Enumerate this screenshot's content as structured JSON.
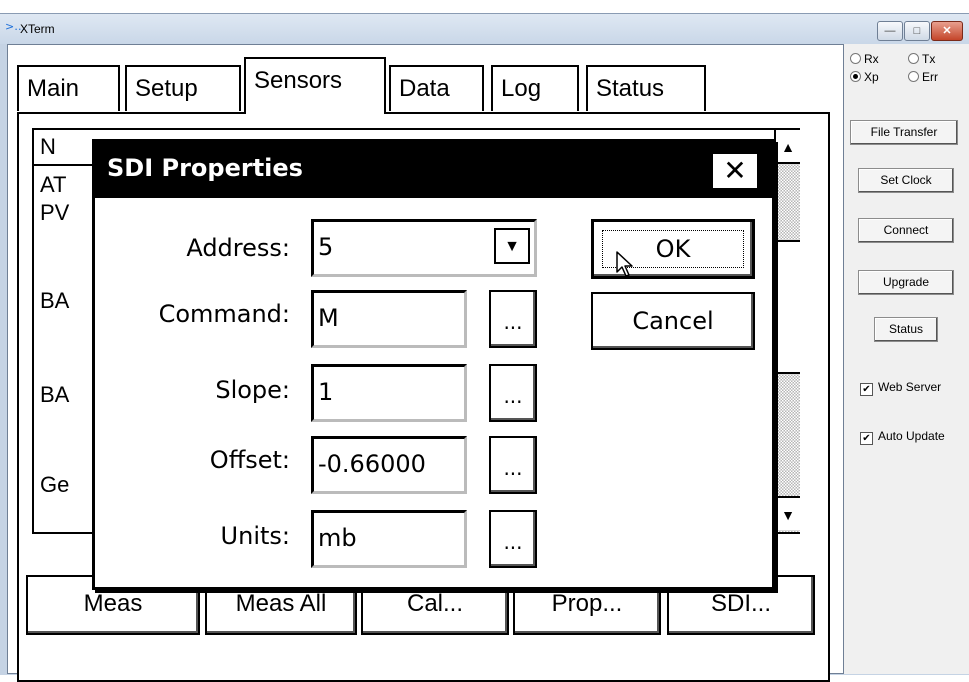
{
  "window": {
    "title": "XTerm",
    "icon": "xterm-app-icon",
    "controls": [
      "minimize",
      "maximize",
      "close"
    ]
  },
  "tabs": [
    {
      "label": "Main"
    },
    {
      "label": "Setup"
    },
    {
      "label": "Sensors",
      "active": true
    },
    {
      "label": "Data"
    },
    {
      "label": "Log"
    },
    {
      "label": "Status"
    }
  ],
  "sensor_list": {
    "header_partial": "N",
    "rows_partial": [
      "AT",
      "PV",
      "BA",
      "BA",
      "Ge"
    ]
  },
  "bottom_buttons": [
    "Meas",
    "Meas All",
    "Cal...",
    "Prop...",
    "SDI..."
  ],
  "right_panel": {
    "radios": [
      {
        "label": "Rx",
        "checked": false
      },
      {
        "label": "Tx",
        "checked": false
      },
      {
        "label": "Xp",
        "checked": true
      },
      {
        "label": "Err",
        "checked": false
      }
    ],
    "buttons": [
      "File Transfer",
      "Set Clock",
      "Connect",
      "Upgrade",
      "Status"
    ],
    "checkboxes": [
      {
        "label": "Web Server",
        "checked": true
      },
      {
        "label": "Auto Update",
        "checked": true
      }
    ]
  },
  "dialog": {
    "title": "SDI Properties",
    "close_glyph": "✕",
    "fields": {
      "address": {
        "label": "Address:",
        "value": "5"
      },
      "command": {
        "label": "Command:",
        "value": "M"
      },
      "slope": {
        "label": "Slope:",
        "value": "1"
      },
      "offset": {
        "label": "Offset:",
        "value": "-0.66000"
      },
      "units": {
        "label": "Units:",
        "value": "mb"
      }
    },
    "ellipsis_label": "...",
    "ok_label": "OK",
    "cancel_label": "Cancel"
  }
}
